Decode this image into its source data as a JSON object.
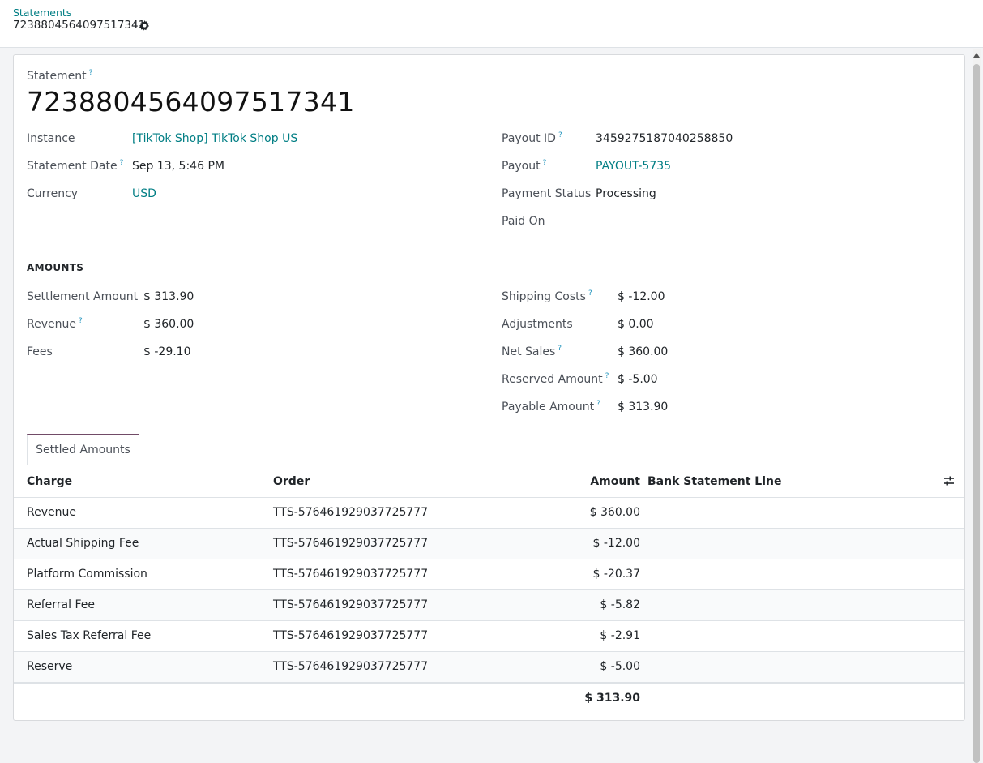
{
  "breadcrumb": {
    "parent": "Statements",
    "current": "7238804564097517341"
  },
  "form": {
    "statement_label": "Statement",
    "title": "7238804564097517341",
    "left": [
      {
        "label": "Instance",
        "value": "[TikTok Shop] TikTok Shop US",
        "help": ""
      },
      {
        "label": "Statement Date",
        "value": "Sep 13, 5:46 PM",
        "help": "?"
      },
      {
        "label": "Currency",
        "value": "USD",
        "help": ""
      }
    ],
    "right": [
      {
        "label": "Payout ID",
        "value": "3459275187040258850",
        "help": "?"
      },
      {
        "label": "Payout",
        "value": "PAYOUT-5735",
        "help": "?"
      },
      {
        "label": "Payment Status",
        "value": "Processing",
        "help": ""
      },
      {
        "label": "Paid On",
        "value": "",
        "help": ""
      }
    ],
    "help_mark": "?"
  },
  "amounts": {
    "heading": "AMOUNTS",
    "left": [
      {
        "label": "Settlement Amount",
        "value": "$ 313.90"
      },
      {
        "label": "Revenue",
        "value": "$ 360.00"
      },
      {
        "label": "Fees",
        "value": "$ -29.10"
      }
    ],
    "right": [
      {
        "label": "Shipping Costs",
        "value": "$ -12.00"
      },
      {
        "label": "Adjustments",
        "value": "$ 0.00"
      },
      {
        "label": "Net Sales",
        "value": "$ 360.00"
      },
      {
        "label": "Reserved Amount",
        "value": "$ -5.00"
      },
      {
        "label": "Payable Amount",
        "value": "$ 313.90"
      }
    ]
  },
  "tab": {
    "label": "Settled Amounts"
  },
  "table": {
    "columns": [
      "Charge",
      "Order",
      "Amount",
      "Bank Statement Line"
    ],
    "rows": [
      {
        "charge": "Revenue",
        "order": "TTS-576461929037725777",
        "amount": "$ 360.00",
        "bank_line": ""
      },
      {
        "charge": "Actual Shipping Fee",
        "order": "TTS-576461929037725777",
        "amount": "$ -12.00",
        "bank_line": ""
      },
      {
        "charge": "Platform Commission",
        "order": "TTS-576461929037725777",
        "amount": "$ -20.37",
        "bank_line": ""
      },
      {
        "charge": "Referral Fee",
        "order": "TTS-576461929037725777",
        "amount": "$ -5.82",
        "bank_line": ""
      },
      {
        "charge": "Sales Tax Referral Fee",
        "order": "TTS-576461929037725777",
        "amount": "$ -2.91",
        "bank_line": ""
      },
      {
        "charge": "Reserve",
        "order": "TTS-576461929037725777",
        "amount": "$ -5.00",
        "bank_line": ""
      }
    ],
    "total": "$ 313.90"
  },
  "colors": {
    "link": "#017e84",
    "tab_accent": "#714b67",
    "help": "#2596be"
  },
  "icons": {
    "gear": "gear-icon",
    "column_settings": "sliders-icon"
  }
}
